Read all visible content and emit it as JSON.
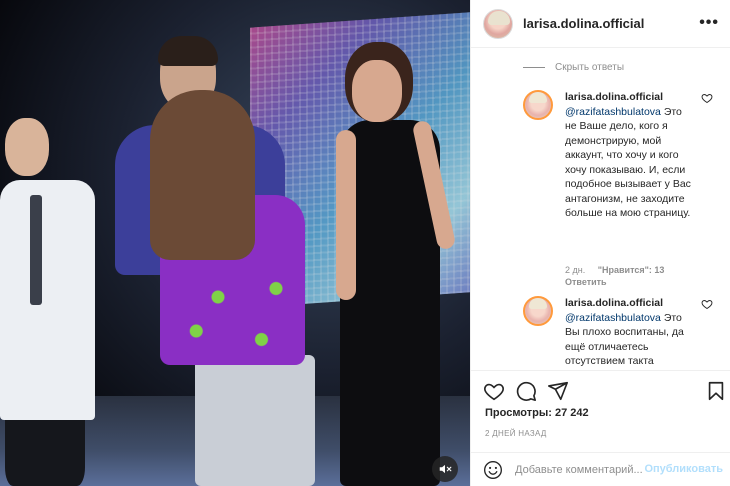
{
  "post": {
    "username": "larisa.dolina.official",
    "more_icon": "more-horizontal-icon"
  },
  "comments": {
    "hide_replies_label": "Скрыть ответы",
    "replies": [
      {
        "username": "larisa.dolina.official",
        "mention": "@razifatashbulatova",
        "text": "Это не Ваше дело, кого я демонстрирую, мой аккаунт, что хочу и кого хочу показываю. И, если подобное вызывает у Вас антагонизм, не заходите больше на мою страницу.",
        "time": "2 дн.",
        "likes": "\"Нравится\": 13",
        "reply_label": "Ответить"
      },
      {
        "username": "larisa.dolina.official",
        "mention": "@razifatashbulatova",
        "text": "Это Вы плохо воспитаны, да ещё отличаетесь отсутствием такта"
      }
    ]
  },
  "actions": {
    "like_icon": "heart-icon",
    "comment_icon": "comment-icon",
    "share_icon": "send-icon",
    "save_icon": "bookmark-icon"
  },
  "stats": {
    "views": "Просмотры: 27 242",
    "date": "2 ДНЕЙ НАЗАД"
  },
  "composer": {
    "emoji_icon": "emoji-icon",
    "placeholder": "Добавьте комментарий...",
    "publish_label": "Опубликовать"
  },
  "media": {
    "mute_icon": "volume-muted-icon"
  },
  "colors": {
    "text": "#262626",
    "secondary": "#8e8e8e",
    "link": "#00376b",
    "publish_disabled": "#b2dffc",
    "border": "#efefef"
  }
}
